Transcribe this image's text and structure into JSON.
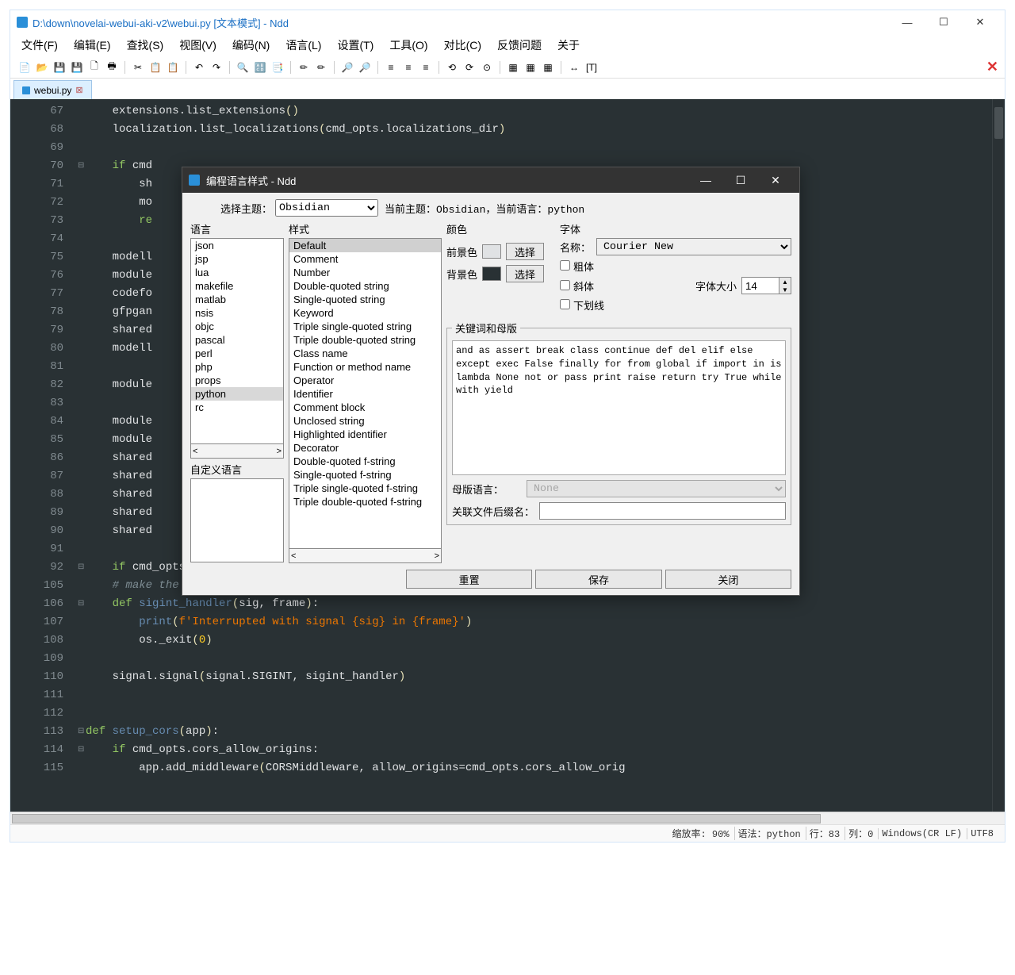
{
  "title": "D:\\down\\novelai-webui-aki-v2\\webui.py [文本模式] - Ndd",
  "menu": [
    "文件(F)",
    "编辑(E)",
    "查找(S)",
    "视图(V)",
    "编码(N)",
    "语言(L)",
    "设置(T)",
    "工具(O)",
    "对比(C)",
    "反馈问题",
    "关于"
  ],
  "tab": {
    "name": "webui.py"
  },
  "lines": [
    {
      "n": "67",
      "fold": "",
      "html": "extensions.list_extensions<span class='op'>()</span>"
    },
    {
      "n": "68",
      "fold": "",
      "html": "localization.list_localizations<span class='op'>(</span>cmd_opts.localizations_dir<span class='op'>)</span>"
    },
    {
      "n": "69",
      "fold": "",
      "html": ""
    },
    {
      "n": "70",
      "fold": "⊟",
      "html": "<span class='kw'>if</span> cmd"
    },
    {
      "n": "71",
      "fold": "",
      "html": "    sh"
    },
    {
      "n": "72",
      "fold": "",
      "html": "    mo"
    },
    {
      "n": "73",
      "fold": "",
      "html": "    <span class='kw'>re</span>"
    },
    {
      "n": "74",
      "fold": "",
      "html": ""
    },
    {
      "n": "75",
      "fold": "",
      "html": "modell"
    },
    {
      "n": "76",
      "fold": "",
      "html": "module"
    },
    {
      "n": "77",
      "fold": "",
      "html": "codefo"
    },
    {
      "n": "78",
      "fold": "",
      "html": "gfpgan"
    },
    {
      "n": "79",
      "fold": "",
      "html": "shared                                                                              <span class='op'>))</span>"
    },
    {
      "n": "80",
      "fold": "",
      "html": "modell"
    },
    {
      "n": "81",
      "fold": "",
      "html": ""
    },
    {
      "n": "82",
      "fold": "",
      "html": "module"
    },
    {
      "n": "83",
      "fold": "",
      "html": ""
    },
    {
      "n": "84",
      "fold": "",
      "html": "module"
    },
    {
      "n": "85",
      "fold": "",
      "html": "module"
    },
    {
      "n": "86",
      "fold": "",
      "html": "shared                                                                              odules"
    },
    {
      "n": "87",
      "fold": "",
      "html": "shared                                                                              .reload"
    },
    {
      "n": "88",
      "fold": "",
      "html": "shared                                                                              ules.sd"
    },
    {
      "n": "89",
      "fold": "",
      "html": "shared                                                                              es.hype"
    },
    {
      "n": "90",
      "fold": "",
      "html": "shared                                                                              .hyperm"
    },
    {
      "n": "91",
      "fold": "",
      "html": ""
    },
    {
      "n": "92",
      "fold": "⊟",
      "html": "<span class='kw'>if</span> cmd_opts.tls_keyfile <span class='kw'>is not</span> None <span class='kw'>and</span> cmd_opts.tls_keyfile <span class='kw'>is not</span> None:"
    },
    {
      "n": "105",
      "fold": "",
      "html": "<span class='cm'># make the program just exit at ctrl+c without waiting for anything</span>"
    },
    {
      "n": "106",
      "fold": "⊟",
      "html": "<span class='kw'>def</span> <span class='fn'>sigint_handler</span><span class='op'>(</span>sig, frame<span class='op'>)</span>:"
    },
    {
      "n": "107",
      "fold": "",
      "html": "    <span class='fn'>print</span><span class='op'>(</span><span class='st'>f'Interrupted with signal {sig} in {frame}'</span><span class='op'>)</span>"
    },
    {
      "n": "108",
      "fold": "",
      "html": "    os._exit<span class='op'>(</span><span class='nm'>0</span><span class='op'>)</span>"
    },
    {
      "n": "109",
      "fold": "",
      "html": ""
    },
    {
      "n": "110",
      "fold": "",
      "html": "signal.signal<span class='op'>(</span>signal.SIGINT, sigint_handler<span class='op'>)</span>"
    },
    {
      "n": "111",
      "fold": "",
      "html": ""
    },
    {
      "n": "112",
      "fold": "",
      "html": ""
    },
    {
      "n": "113",
      "fold": "⊟",
      "html": "<span class='kw'>def</span> <span class='fn'>setup_cors</span><span class='op'>(</span>app<span class='op'>)</span>:",
      "dedent": true
    },
    {
      "n": "114",
      "fold": "⊟",
      "html": "<span class='kw'>if</span> cmd_opts.cors_allow_origins:"
    },
    {
      "n": "115",
      "fold": "",
      "html": "    app.add_middleware<span class='op'>(</span>CORSMiddleware, allow_origins=cmd_opts.cors_allow_orig"
    }
  ],
  "status": {
    "zoom": "缩放率: 90%",
    "lang": "语法：python",
    "line": "行：83",
    "col": "列：0",
    "eol": "Windows(CR LF)",
    "enc": "UTF8"
  },
  "dialog": {
    "title": "编程语言样式 - Ndd",
    "theme_label": "选择主题：",
    "theme_value": "Obsidian",
    "current": "当前主题：Obsidian，当前语言：python",
    "lang_label": "语言",
    "style_label": "样式",
    "color_label": "颜色",
    "font_label": "字体",
    "fg_label": "前景色",
    "bg_label": "背景色",
    "choose": "选择",
    "font_name_label": "名称：",
    "font_name": "Courier New",
    "bold": "粗体",
    "italic": "斜体",
    "underline": "下划线",
    "font_size_label": "字体大小",
    "font_size": "14",
    "keyword_fs": "关键词和母版",
    "keywords": "and as assert break class continue def del elif else except exec False finally for from global if import in is lambda None not or pass print raise return try True while with yield",
    "tmpl_label": "母版语言：",
    "tmpl_value": "None",
    "ext_label": "关联文件后缀名：",
    "ext_value": "",
    "custom_lang_label": "自定义语言",
    "btn_reset": "重置",
    "btn_save": "保存",
    "btn_close": "关闭",
    "langs": [
      "json",
      "jsp",
      "lua",
      "makefile",
      "matlab",
      "nsis",
      "objc",
      "pascal",
      "perl",
      "php",
      "props",
      "python",
      "rc"
    ],
    "styles": [
      "Default",
      "Comment",
      "Number",
      "Double-quoted string",
      "Single-quoted string",
      "Keyword",
      "Triple single-quoted string",
      "Triple double-quoted string",
      "Class name",
      "Function or method name",
      "Operator",
      "Identifier",
      "Comment block",
      "Unclosed string",
      "Highlighted identifier",
      "Decorator",
      "Double-quoted f-string",
      "Single-quoted f-string",
      "Triple single-quoted f-string",
      "Triple double-quoted f-string"
    ]
  }
}
